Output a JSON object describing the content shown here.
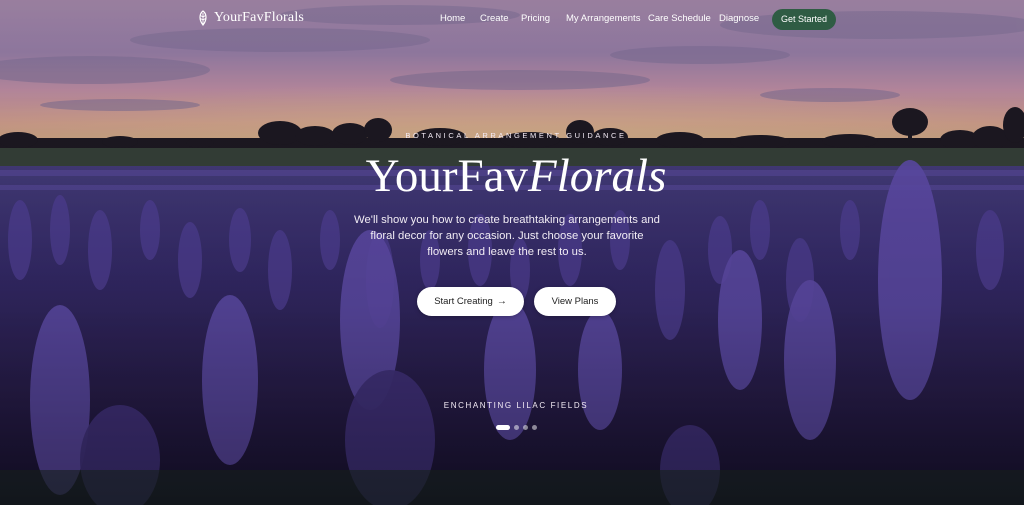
{
  "brand": {
    "name": "YourFavFlorals",
    "logo_icon": "leaf-icon"
  },
  "nav": {
    "links": [
      "Home",
      "Create",
      "Pricing",
      "My Arrangements",
      "Care Schedule",
      "Diagnose"
    ],
    "cta_label": "Get Started"
  },
  "hero": {
    "eyebrow": "BOTANICAL ARRANGEMENT GUIDANCE",
    "title_regular": "YourFav",
    "title_italic": "Florals",
    "subtitle": "We'll show you how to create breathtaking arrangements and floral decor for any occasion. Just choose your favorite flowers and leave the rest to us.",
    "primary_button": "Start Creating",
    "primary_button_icon": "arrow-right-icon",
    "secondary_button": "View Plans",
    "caption": "ENCHANTING LILAC FIELDS",
    "slide_count": 4,
    "active_slide": 1
  },
  "colors": {
    "accent_green": "#2f5c44",
    "lilac": "#5b4aa0",
    "sky_pink": "#e7a6b4"
  }
}
